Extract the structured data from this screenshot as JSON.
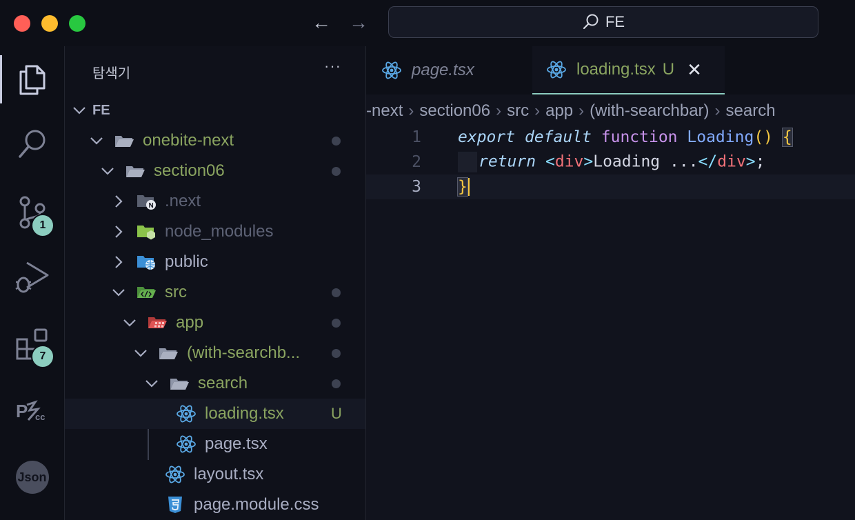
{
  "window": {
    "search_text": "FE"
  },
  "activity_bar": {
    "items": [
      {
        "icon": "files-icon",
        "badge": ""
      },
      {
        "icon": "search-icon",
        "badge": ""
      },
      {
        "icon": "source-control-icon",
        "badge": "1"
      },
      {
        "icon": "run-debug-icon",
        "badge": ""
      },
      {
        "icon": "extensions-icon",
        "badge": "7"
      },
      {
        "icon": "ps-cc-icon",
        "badge": ""
      },
      {
        "icon": "json-icon",
        "label": "Json"
      }
    ]
  },
  "sidebar": {
    "title": "탐색기",
    "more": "···",
    "root": "FE",
    "tree": [
      {
        "name": "onebite-next",
        "status": "dot"
      },
      {
        "name": "section06",
        "status": "dot"
      },
      {
        "name": ".next",
        "status": ""
      },
      {
        "name": "node_modules",
        "status": ""
      },
      {
        "name": "public",
        "status": ""
      },
      {
        "name": "src",
        "status": "dot"
      },
      {
        "name": "app",
        "status": "dot"
      },
      {
        "name": "(with-searchb...",
        "status": "dot"
      },
      {
        "name": "search",
        "status": "dot"
      },
      {
        "name": "loading.tsx",
        "status": "U"
      },
      {
        "name": "page.tsx",
        "status": ""
      },
      {
        "name": "layout.tsx",
        "status": ""
      },
      {
        "name": "page.module.css",
        "status": ""
      }
    ]
  },
  "editor": {
    "tabs": [
      {
        "name": "page.tsx",
        "status": ""
      },
      {
        "name": "loading.tsx",
        "status": "U",
        "close": "✕"
      }
    ],
    "breadcrumb": [
      "-next",
      "section06",
      "src",
      "app",
      "(with-searchbar)",
      "search"
    ],
    "breadcrumb_sep": "›",
    "line_numbers": [
      "1",
      "2",
      "3"
    ],
    "code": {
      "l1_export": "export",
      "l1_default": "default",
      "l1_function": "function",
      "l1_name": "Loading",
      "l1_parens": "()",
      "l1_brace": "{",
      "l2_return": "return",
      "l2_open_lt": "<",
      "l2_open_tag": "div",
      "l2_open_gt": ">",
      "l2_text": "Loading ...",
      "l2_close_lt": "</",
      "l2_close_tag": "div",
      "l2_close_gt": ">",
      "l2_semi": ";",
      "l3_brace": "}"
    }
  },
  "colors": {
    "accent": "#8ccdbf",
    "untracked": "#8aa460",
    "keyword": "#c792ea",
    "function": "#82aaff",
    "bracket": "#f5c842",
    "tag": "#f07178"
  }
}
